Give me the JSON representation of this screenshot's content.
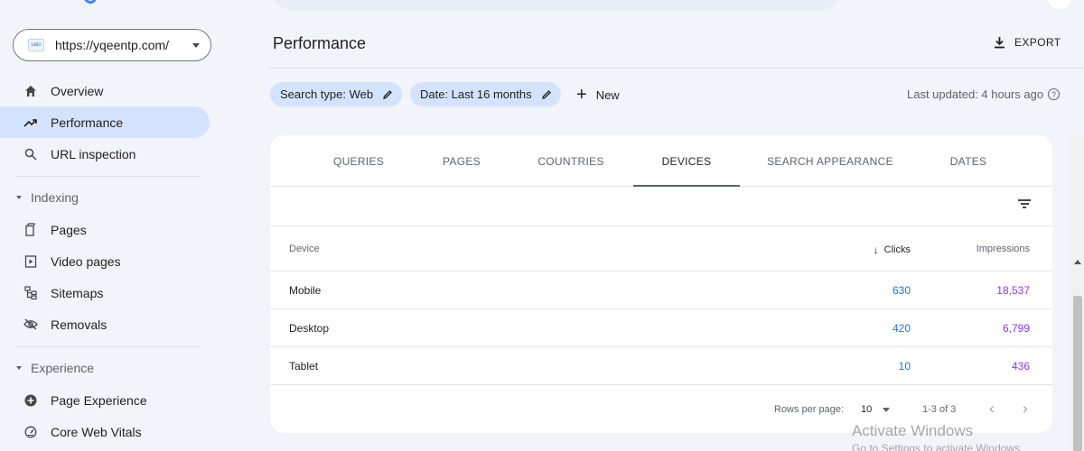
{
  "property": {
    "url": "https://yqeentp.com/",
    "favicon": "ualo"
  },
  "sidebar": {
    "overview": "Overview",
    "performance": "Performance",
    "url_inspection": "URL inspection",
    "indexing_section": "Indexing",
    "pages": "Pages",
    "video_pages": "Video pages",
    "sitemaps": "Sitemaps",
    "removals": "Removals",
    "experience_section": "Experience",
    "page_experience": "Page Experience",
    "core_web_vitals": "Core Web Vitals"
  },
  "header": {
    "title": "Performance",
    "export_label": "EXPORT"
  },
  "filters": {
    "search_type": "Search type: Web",
    "date": "Date: Last 16 months",
    "new_label": "New",
    "last_updated": "Last updated: 4 hours ago"
  },
  "tabs": [
    "QUERIES",
    "PAGES",
    "COUNTRIES",
    "DEVICES",
    "SEARCH APPEARANCE",
    "DATES"
  ],
  "active_tab": "DEVICES",
  "table": {
    "columns": {
      "device": "Device",
      "clicks": "Clicks",
      "impressions": "Impressions"
    },
    "sort_indicator": "↓",
    "rows": [
      {
        "device": "Mobile",
        "clicks": "630",
        "impressions": "18,537"
      },
      {
        "device": "Desktop",
        "clicks": "420",
        "impressions": "6,799"
      },
      {
        "device": "Tablet",
        "clicks": "10",
        "impressions": "436"
      }
    ]
  },
  "pagination": {
    "rows_per_page_label": "Rows per page:",
    "rows_per_page": "10",
    "range": "1-3 of 3",
    "prev": "‹",
    "next": "›"
  },
  "watermark": {
    "line1": "Activate Windows",
    "line2": "Go to Settings to activate Windows."
  },
  "colors": {
    "active_bg": "#d3e3fd",
    "clicks": "#1a73e8",
    "impressions": "#9334e6",
    "background": "#f1f4f9"
  }
}
